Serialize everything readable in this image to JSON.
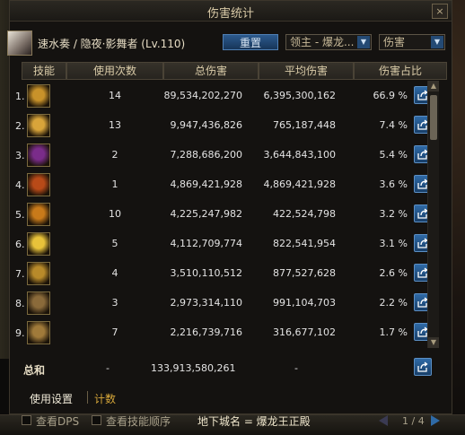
{
  "window": {
    "title": "伤害统计",
    "close_label": "×"
  },
  "character": {
    "name": "速水奏 / 隐夜·影舞者 (Lv.110)"
  },
  "controls": {
    "reset_label": "重置",
    "target_select": "领主 - 爆龙...",
    "metric_select": "伤害"
  },
  "table": {
    "columns": [
      "技能",
      "使用次数",
      "总伤害",
      "平均伤害",
      "伤害占比"
    ],
    "rows": [
      {
        "idx": "1.",
        "count": "14",
        "total": "89,534,202,270",
        "avg": "6,395,300,162",
        "pct": "66.9 %",
        "icon_color": "#c8922a"
      },
      {
        "idx": "2.",
        "count": "13",
        "total": "9,947,436,826",
        "avg": "765,187,448",
        "pct": "7.4 %",
        "icon_color": "#d8a43a"
      },
      {
        "idx": "3.",
        "count": "2",
        "total": "7,288,686,200",
        "avg": "3,644,843,100",
        "pct": "5.4 %",
        "icon_color": "#7a2c8a"
      },
      {
        "idx": "4.",
        "count": "1",
        "total": "4,869,421,928",
        "avg": "4,869,421,928",
        "pct": "3.6 %",
        "icon_color": "#b84a18"
      },
      {
        "idx": "5.",
        "count": "10",
        "total": "4,225,247,982",
        "avg": "422,524,798",
        "pct": "3.2 %",
        "icon_color": "#c87a1a"
      },
      {
        "idx": "6.",
        "count": "5",
        "total": "4,112,709,774",
        "avg": "822,541,954",
        "pct": "3.1 %",
        "icon_color": "#e8c23a"
      },
      {
        "idx": "7.",
        "count": "4",
        "total": "3,510,110,512",
        "avg": "877,527,628",
        "pct": "2.6 %",
        "icon_color": "#b88a2a"
      },
      {
        "idx": "8.",
        "count": "3",
        "total": "2,973,314,110",
        "avg": "991,104,703",
        "pct": "2.2 %",
        "icon_color": "#8a6a3a"
      },
      {
        "idx": "9.",
        "count": "7",
        "total": "2,216,739,716",
        "avg": "316,677,102",
        "pct": "1.7 %",
        "icon_color": "#a07a3a"
      }
    ],
    "total": {
      "label": "总和",
      "count": "-",
      "total": "133,913,580,261",
      "avg": "-"
    }
  },
  "footer": {
    "tab_settings": "使用设置",
    "tab_count": "计数"
  },
  "bottom": {
    "show_dps": "查看DPS",
    "show_order": "查看技能顺序",
    "dungeon": "地下城名 = 爆龙王正殿",
    "page": "1 / 4"
  },
  "colors": {
    "accent_blue": "#2f6aa6",
    "gold_text": "#d9cba8",
    "tab_active": "#f0ead8",
    "tab_inactive": "#d8a83a"
  }
}
